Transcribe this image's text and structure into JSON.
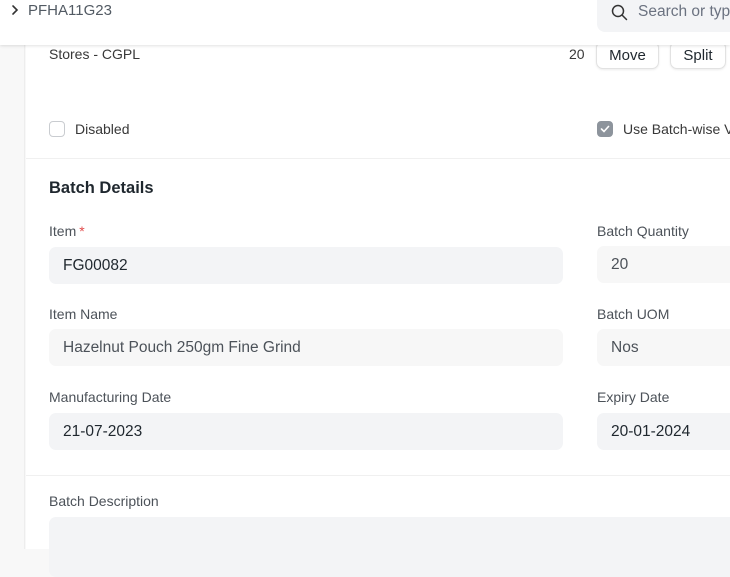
{
  "topbar": {
    "breadcrumb": "PFHA11G23",
    "breadcrumb_chevron_icon": "chevron-right-icon",
    "search_placeholder": "Search or type a command",
    "search_visible_text": "Search or typ",
    "search_icon": "search-icon"
  },
  "stock_row": {
    "warehouse": "Stores - CGPL",
    "quantity": "20",
    "move_label": "Move",
    "split_label": "Split"
  },
  "checkboxes": {
    "disabled": {
      "label": "Disabled",
      "checked": false
    },
    "use_batchwise": {
      "label": "Use Batch-wise Valuation",
      "visible_label": "Use Batch-wise V",
      "checked": true
    }
  },
  "batch_details": {
    "title": "Batch Details",
    "item": {
      "label": "Item",
      "required_mark": "*",
      "value": "FG00082"
    },
    "item_name": {
      "label": "Item Name",
      "value": "Hazelnut Pouch 250gm Fine Grind"
    },
    "manufacturing_date": {
      "label": "Manufacturing Date",
      "value": "21-07-2023"
    },
    "batch_quantity": {
      "label": "Batch Quantity",
      "value": "20"
    },
    "batch_uom": {
      "label": "Batch UOM",
      "value": "Nos"
    },
    "expiry_date": {
      "label": "Expiry Date",
      "value": "20-01-2024"
    },
    "batch_description": {
      "label": "Batch Description",
      "value": ""
    }
  }
}
